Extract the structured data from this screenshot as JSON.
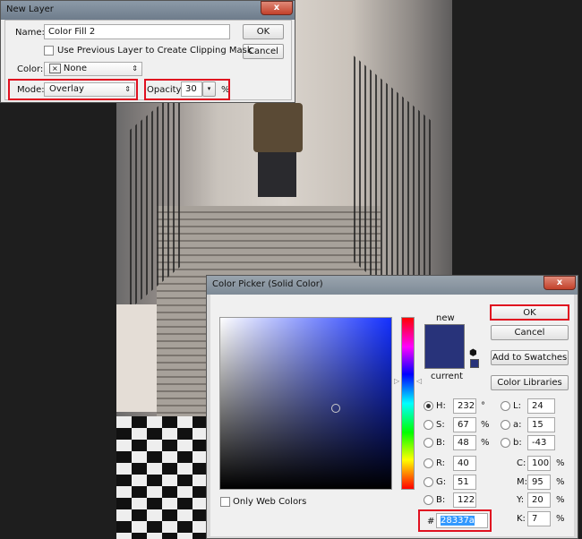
{
  "new_layer": {
    "title": "New Layer",
    "close": "x",
    "name_label": "Name:",
    "name_value": "Color Fill 2",
    "ok": "OK",
    "cancel": "Cancel",
    "clip_label": "Use Previous Layer to Create Clipping Mask",
    "color_label": "Color:",
    "color_value": "None",
    "color_x": "×",
    "mode_label": "Mode:",
    "mode_value": "Overlay",
    "opacity_label": "Opacity:",
    "opacity_value": "30",
    "opacity_unit": "%"
  },
  "picker": {
    "title": "Color Picker (Solid Color)",
    "close": "x",
    "ok": "OK",
    "cancel": "Cancel",
    "add_swatches": "Add to Swatches",
    "color_libraries": "Color Libraries",
    "new_label": "new",
    "current_label": "current",
    "only_web": "Only Web Colors",
    "new_color": "#28337a",
    "hsb": [
      {
        "label": "H:",
        "value": "232",
        "unit": "°",
        "selected": true
      },
      {
        "label": "S:",
        "value": "67",
        "unit": "%"
      },
      {
        "label": "B:",
        "value": "48",
        "unit": "%"
      }
    ],
    "rgb": [
      {
        "label": "R:",
        "value": "40"
      },
      {
        "label": "G:",
        "value": "51"
      },
      {
        "label": "B:",
        "value": "122"
      }
    ],
    "lab": [
      {
        "label": "L:",
        "value": "24"
      },
      {
        "label": "a:",
        "value": "15"
      },
      {
        "label": "b:",
        "value": "-43"
      }
    ],
    "cmyk": [
      {
        "label": "C:",
        "value": "100",
        "unit": "%"
      },
      {
        "label": "M:",
        "value": "95",
        "unit": "%"
      },
      {
        "label": "Y:",
        "value": "20",
        "unit": "%"
      },
      {
        "label": "K:",
        "value": "7",
        "unit": "%"
      }
    ],
    "hex_label": "#",
    "hex_value": "28337a"
  }
}
